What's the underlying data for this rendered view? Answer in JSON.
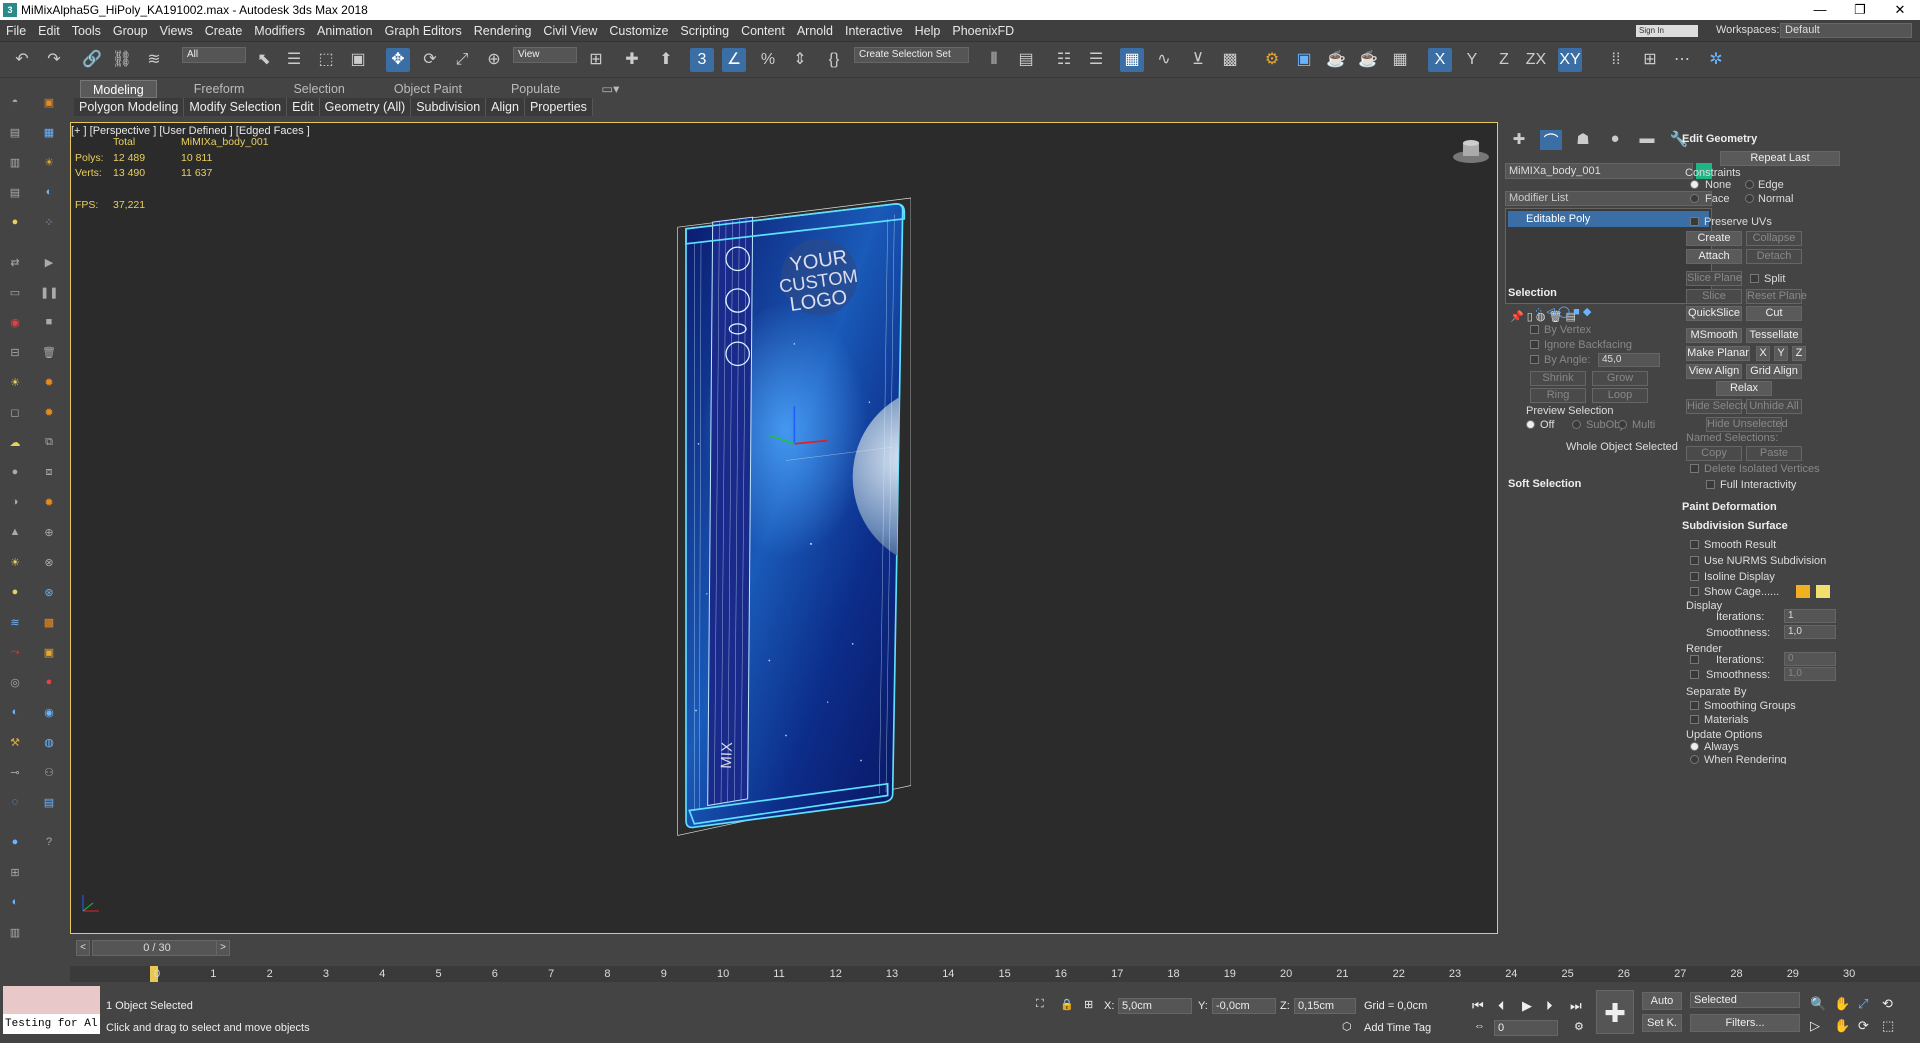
{
  "window": {
    "title": "MiMixAlpha5G_HiPoly_KA191002.max - Autodesk 3ds Max 2018",
    "app_icon": "3ds-max-logo-icon"
  },
  "menu": [
    "File",
    "Edit",
    "Tools",
    "Group",
    "Views",
    "Create",
    "Modifiers",
    "Animation",
    "Graph Editors",
    "Rendering",
    "Civil View",
    "Customize",
    "Scripting",
    "Content",
    "Arnold",
    "Interactive",
    "Help",
    "PhoenixFD"
  ],
  "account": {
    "signin": "Sign In",
    "workspaces_label": "Workspaces:",
    "workspace_value": "Default"
  },
  "toolbar": {
    "filter_value": "All",
    "ref_coord_value": "View",
    "selection_set_value": "Create Selection Set"
  },
  "ribbon": {
    "tabs": [
      "Modeling",
      "Freeform",
      "Selection",
      "Object Paint",
      "Populate"
    ],
    "active_tab": "Modeling",
    "subtabs": [
      "Polygon Modeling",
      "Modify Selection",
      "Edit",
      "Geometry (All)",
      "Subdivision",
      "Align",
      "Properties"
    ]
  },
  "viewport": {
    "label": "[+ ] [Perspective ] [User Defined ] [Edged Faces ]",
    "stats": {
      "col_total": "Total",
      "col_object": "MiMIXa_body_001",
      "polys_label": "Polys:",
      "polys_total": "12 489",
      "polys_obj": "10 811",
      "verts_label": "Verts:",
      "verts_total": "13 490",
      "verts_obj": "11 637",
      "fps_label": "FPS:",
      "fps_value": "37,221"
    },
    "logo_lines": [
      "YOUR",
      "CUSTOM",
      "LOGO"
    ],
    "mix_text": "MIX"
  },
  "command_panel": {
    "object_name": "MiMIXa_body_001",
    "object_color": "#1fb585",
    "modifier_list": "Modifier List",
    "stack_item": "Editable Poly",
    "selection": {
      "title": "Selection",
      "by_vertex": "By Vertex",
      "ignore_backfacing": "Ignore Backfacing",
      "by_angle": "By Angle:",
      "angle_value": "45,0",
      "shrink": "Shrink",
      "grow": "Grow",
      "ring": "Ring",
      "loop": "Loop",
      "preview": "Preview Selection",
      "off": "Off",
      "subobj": "SubObj",
      "multi": "Multi",
      "status": "Whole Object Selected"
    },
    "soft_selection": "Soft Selection",
    "edit_geometry": {
      "title": "Edit Geometry",
      "repeat_last": "Repeat Last",
      "constraints": "Constraints",
      "none": "None",
      "edge": "Edge",
      "face": "Face",
      "normal": "Normal",
      "preserve_uvs": "Preserve UVs",
      "create": "Create",
      "collapse": "Collapse",
      "attach": "Attach",
      "detach": "Detach",
      "slice_plane": "Slice Plane",
      "split": "Split",
      "slice": "Slice",
      "reset_plane": "Reset Plane",
      "quickslice": "QuickSlice",
      "cut": "Cut",
      "msmooth": "MSmooth",
      "tessellate": "Tessellate",
      "make_planar": "Make Planar",
      "x": "X",
      "y": "Y",
      "z": "Z",
      "view_align": "View Align",
      "grid_align": "Grid Align",
      "relax": "Relax",
      "hide_selected": "Hide Selected",
      "unhide_all": "Unhide All",
      "hide_unselected": "Hide Unselected",
      "named_selections": "Named Selections:",
      "copy": "Copy",
      "paste": "Paste",
      "delete_isolated": "Delete Isolated Vertices",
      "full_interactivity": "Full Interactivity"
    },
    "paint_deformation": "Paint Deformation",
    "subdivision_surface": {
      "title": "Subdivision Surface",
      "smooth_result": "Smooth Result",
      "use_nurms": "Use NURMS Subdivision",
      "isoline": "Isoline Display",
      "show_cage": "Show Cage......",
      "cage_color1": "#f0b020",
      "cage_color2": "#f0e070",
      "display": "Display",
      "iterations": "Iterations:",
      "iter_value": "1",
      "smoothness": "Smoothness:",
      "smooth_value": "1,0",
      "render": "Render",
      "r_iter_value": "0",
      "r_smooth_value": "1,0",
      "separate_by": "Separate By",
      "smoothing_groups": "Smoothing Groups",
      "materials": "Materials",
      "update_options": "Update Options",
      "always": "Always",
      "when_rendering": "When Rendering"
    }
  },
  "timeline": {
    "slider": "0 / 30",
    "ticks": [
      "0",
      "1",
      "2",
      "3",
      "4",
      "5",
      "6",
      "7",
      "8",
      "9",
      "10",
      "11",
      "12",
      "13",
      "14",
      "15",
      "16",
      "17",
      "18",
      "19",
      "20",
      "21",
      "22",
      "23",
      "24",
      "25",
      "26",
      "27",
      "28",
      "29",
      "30"
    ]
  },
  "status": {
    "selected": "1 Object Selected",
    "prompt": "Click and drag to select and move objects",
    "maxscript": "Testing for Al",
    "x_label": "X:",
    "x_value": "5,0cm",
    "y_label": "Y:",
    "y_value": "-0,0cm",
    "z_label": "Z:",
    "z_value": "0,15cm",
    "grid": "Grid = 0,0cm",
    "add_time_tag": "Add Time Tag",
    "auto": "Auto",
    "set_k": "Set K.",
    "selected_dd": "Selected",
    "filters": "Filters...",
    "frame": "0"
  }
}
